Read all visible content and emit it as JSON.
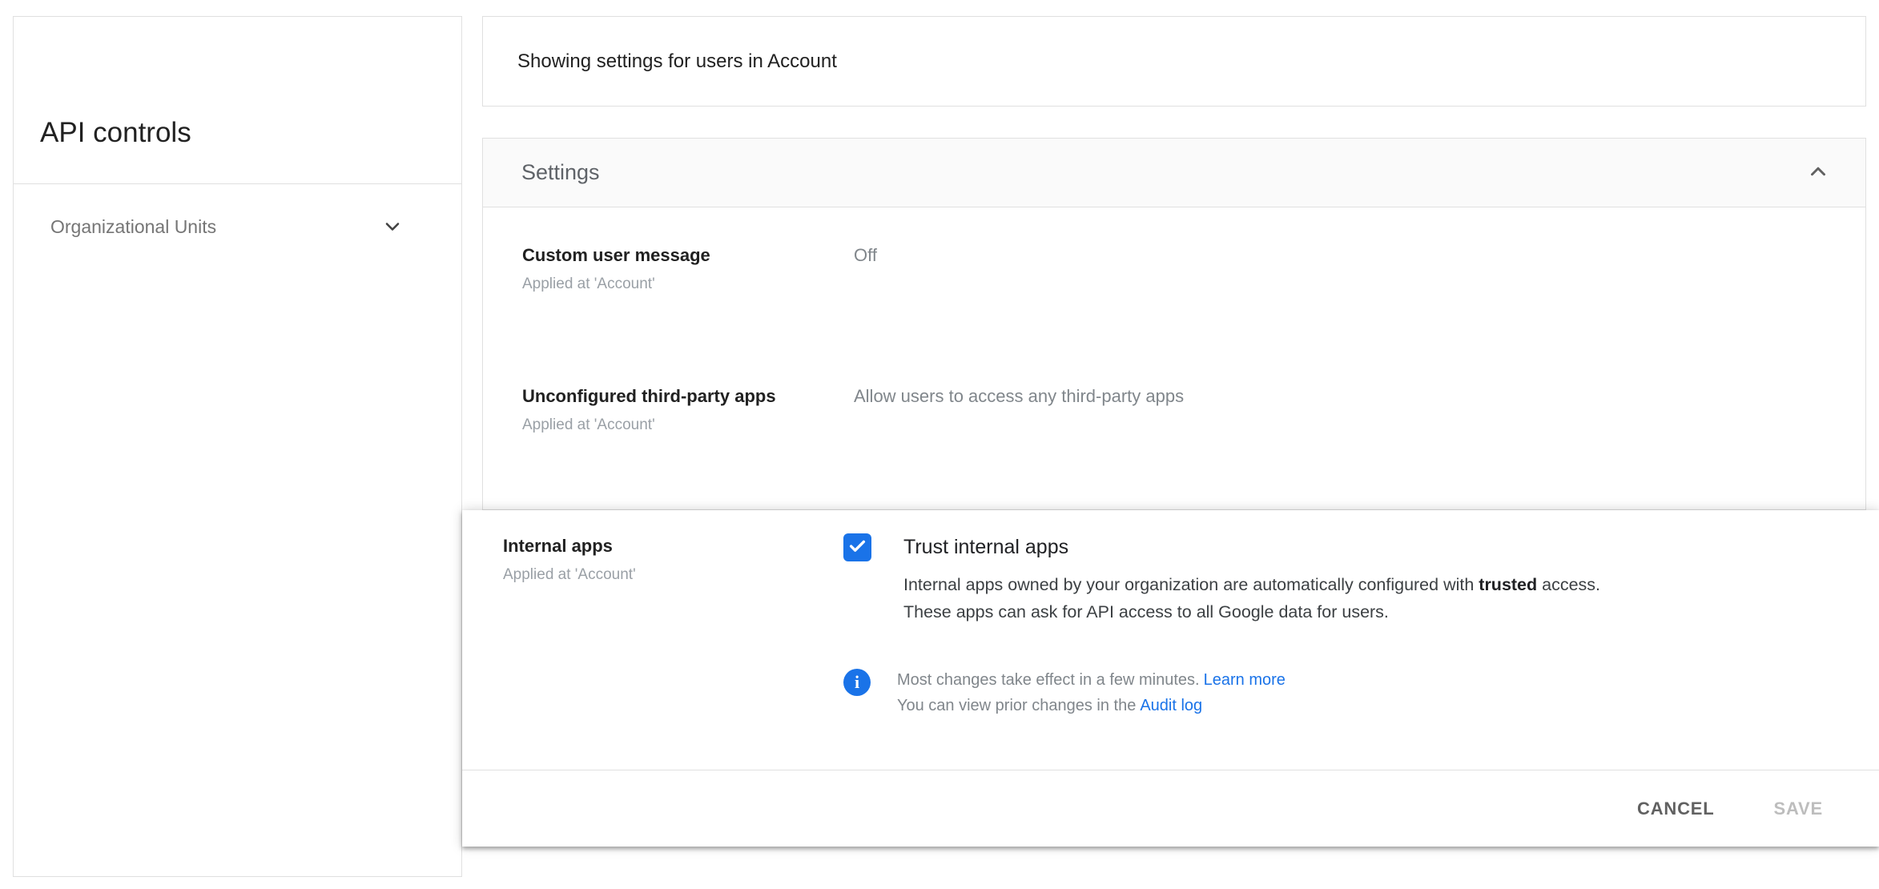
{
  "sidebar": {
    "title": "API controls",
    "org_units_label": "Organizational Units"
  },
  "topbar": {
    "scope_text": "Showing settings for users in Account"
  },
  "settings_card": {
    "title": "Settings",
    "rows": [
      {
        "label": "Custom user message",
        "applied": "Applied at 'Account'",
        "value": "Off"
      },
      {
        "label": "Unconfigured third-party apps",
        "applied": "Applied at 'Account'",
        "value": "Allow users to access any third-party apps"
      }
    ]
  },
  "panel": {
    "label": "Internal apps",
    "applied": "Applied at 'Account'",
    "checkbox_checked": true,
    "checkbox_title": "Trust internal apps",
    "desc_pre": "Internal apps owned by your organization are automatically configured with ",
    "desc_bold": "trusted",
    "desc_post": " access.",
    "desc_line2": "These apps can ask for API access to all Google data for users.",
    "note_line1": "Most changes take effect in a few minutes.",
    "note_link1": "Learn more",
    "note_line2": "You can view prior changes in the",
    "note_link2": "Audit log",
    "cancel_label": "CANCEL",
    "save_label": "SAVE"
  },
  "colors": {
    "accent_blue": "#1a73e8",
    "link_blue": "#1a73e8",
    "card_border": "#e0e0e0",
    "header_bg": "#fafafa",
    "muted_text": "#9aa0a6",
    "value_text": "#80868b"
  }
}
